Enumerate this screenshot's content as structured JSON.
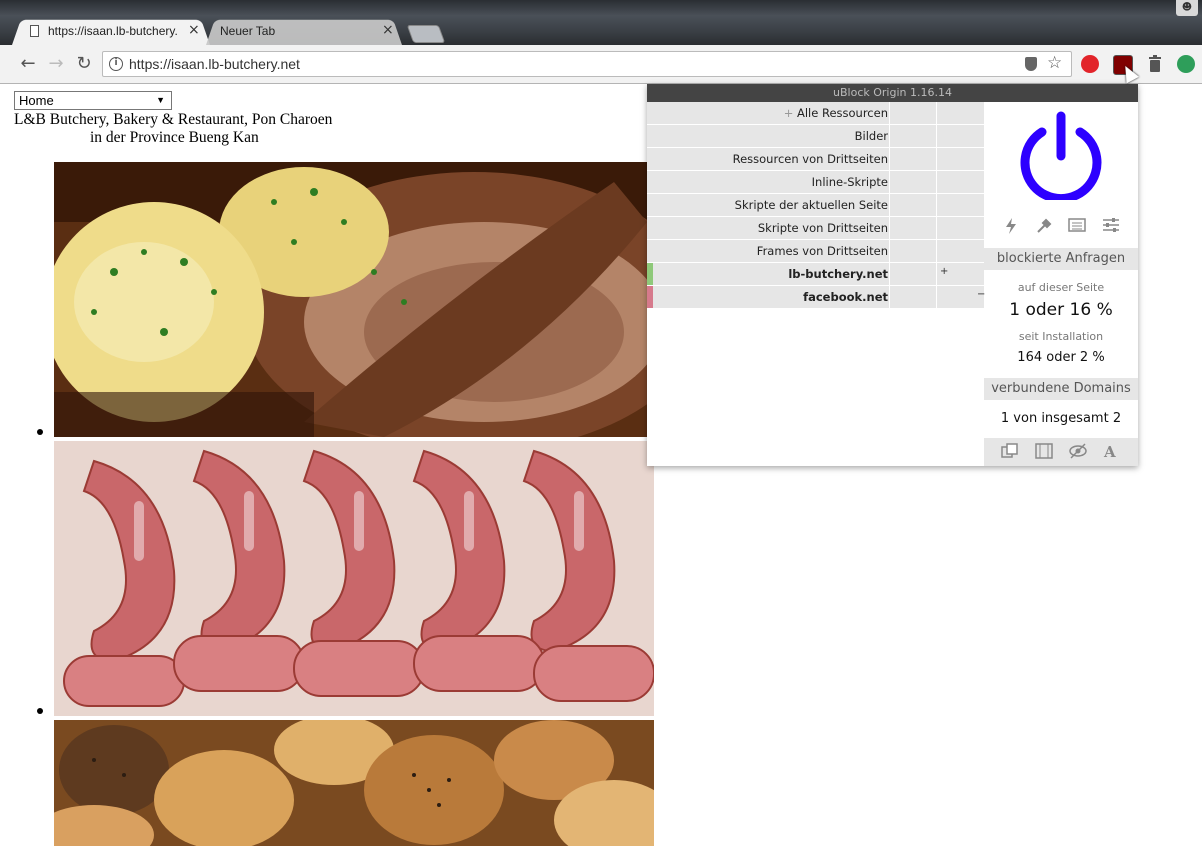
{
  "browser": {
    "tabs": [
      {
        "title": "https://isaan.lb-butchery.",
        "close": "×"
      },
      {
        "title": "Neuer Tab",
        "close": "×"
      }
    ],
    "nav": {
      "back": "←",
      "forward": "→",
      "reload": "↻"
    },
    "url": "https://isaan.lb-butchery.net",
    "info_icon": "i",
    "star": "☆"
  },
  "page": {
    "select_value": "Home",
    "select_arrow": "▼",
    "title_line1": "L&B Butchery, Bakery & Restaurant, Pon Charoen",
    "title_line2": "in der Province Bueng Kan",
    "images": [
      "roast-pork-dumplings-photo",
      "sausages-photo",
      "bread-rolls-photo"
    ]
  },
  "ublock": {
    "header": "uBlock Origin 1.16.14",
    "rows": [
      {
        "label": "Alle Ressourcen",
        "prefix": "+"
      },
      {
        "label": "Bilder"
      },
      {
        "label": "Ressourcen von Drittseiten"
      },
      {
        "label": "Inline-Skripte"
      },
      {
        "label": "Skripte der aktuellen Seite"
      },
      {
        "label": "Skripte von Drittseiten"
      },
      {
        "label": "Frames von Drittseiten"
      },
      {
        "label": "lb-butchery.net",
        "mark": "+"
      },
      {
        "label": "facebook.net",
        "mark": "−"
      }
    ],
    "blocked_heading": "blockierte Anfragen",
    "this_page_label": "auf dieser Seite",
    "this_page_value": "1 oder 16 %",
    "since_install_label": "seit Installation",
    "since_install_value": "164 oder 2 %",
    "domains_heading": "verbundene Domains",
    "domains_value": "1 von insgesamt 2",
    "colors": {
      "power": "#2d00ff",
      "allowed": "#8fc97a",
      "blocked": "#d67a8c"
    }
  }
}
